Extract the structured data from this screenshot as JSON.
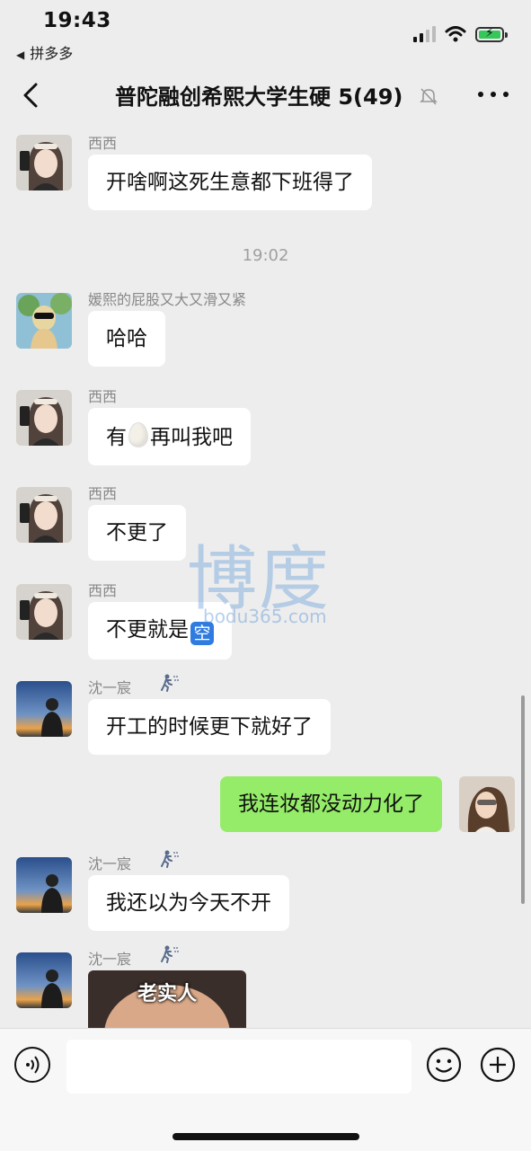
{
  "status_bar": {
    "time": "19:43",
    "back_app": "拼多多"
  },
  "nav": {
    "title": "普陀融创希熙大学生硬 5(49)"
  },
  "chat": {
    "messages": [
      {
        "sender": "西西",
        "text": "开啥啊这死生意都下班得了"
      },
      {
        "timestamp": "19:02"
      },
      {
        "sender": "媛熙的屁股又大又滑又紧",
        "text": "哈哈"
      },
      {
        "sender": "西西",
        "text_before": "有",
        "text_after": "再叫我吧",
        "emoji": "egg"
      },
      {
        "sender": "西西",
        "text": "不更了"
      },
      {
        "sender": "西西",
        "text": "不更就是",
        "emoji_text": "空"
      },
      {
        "sender": "沈一宸",
        "text": "开工的时候更下就好了",
        "badge": "running-man-icon"
      },
      {
        "self": true,
        "text": "我连妆都没动力化了"
      },
      {
        "sender": "沈一宸",
        "text": "我还以为今天不开",
        "badge": "running-man-icon"
      },
      {
        "sender": "沈一宸",
        "sticker_caption": "老实人",
        "badge": "running-man-icon"
      }
    ]
  },
  "watermark": {
    "big": "博度",
    "small": "bodu365.com"
  },
  "input_bar": {
    "value": ""
  },
  "colors": {
    "self_bubble": "#95ec69",
    "other_bubble": "#ffffff",
    "background": "#ededed"
  }
}
